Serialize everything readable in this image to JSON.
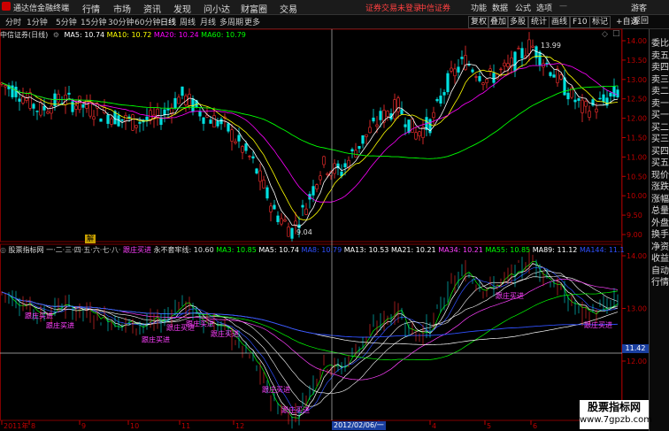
{
  "app": {
    "name": "通达信金融终端",
    "menus": [
      "行情",
      "市场",
      "资讯",
      "发现",
      "问小达",
      "财富圈",
      "交易"
    ],
    "notice": "证券交易未登录",
    "broker": "中信证券",
    "right_menus": [
      "功能",
      "数据",
      "公式",
      "选项"
    ],
    "guest": "游客"
  },
  "toolbar": {
    "periods": [
      "分时",
      "1分钟",
      "5分钟",
      "15分钟",
      "30分钟",
      "60分钟",
      "日线",
      "周线",
      "月线",
      "多周期",
      "更多"
    ],
    "active_period": "日线",
    "buttons": [
      "复权",
      "叠加",
      "多股",
      "统计",
      "画线",
      "F10",
      "标记"
    ],
    "self_select": "+自选",
    "back": "返回"
  },
  "main_chart": {
    "title": "中信证券(日线)",
    "ma": [
      {
        "label": "MA5: 10.74",
        "color": "#ffffff"
      },
      {
        "label": "MA10: 10.72",
        "color": "#ffff00"
      },
      {
        "label": "MA20: 10.24",
        "color": "#ff00ff"
      },
      {
        "label": "MA60: 10.79",
        "color": "#00ff00"
      }
    ],
    "price_ticks": [
      "14.00",
      "13.50",
      "13.00",
      "12.50",
      "12.00",
      "11.50",
      "11.00",
      "10.50",
      "10.00",
      "9.50",
      "9.00"
    ],
    "high_label": "13.99",
    "low_label": "9.04"
  },
  "sub_chart": {
    "title": "股票指标网",
    "numbers": [
      "一",
      "二",
      "三",
      "四",
      "五",
      "六",
      "七",
      "八"
    ],
    "follow_label": "跟庄买进",
    "never_label": "永不套牢线: 10.60",
    "ma": [
      {
        "label": "MA3: 10.85",
        "color": "#00ff00"
      },
      {
        "label": "MA5: 10.74",
        "color": "#ffffff"
      },
      {
        "label": "MA8: 10.79",
        "color": "#3050ff"
      },
      {
        "label": "MA13: 10.53",
        "color": "#ffffff"
      },
      {
        "label": "MA21: 10.21",
        "color": "#ffffff"
      },
      {
        "label": "MA34: 10.21",
        "color": "#ff40ff"
      },
      {
        "label": "MA55: 10.85",
        "color": "#00ff00"
      },
      {
        "label": "MA89: 11.12",
        "color": "#ffffff"
      },
      {
        "label": "MA144: 11.1",
        "color": "#3050ff"
      }
    ],
    "price_ticks": [
      "14.00",
      "13.00",
      "12.00"
    ],
    "current_badge": "11.42",
    "jie_label": "解",
    "buy_signals": [
      "跟庄买进",
      "跟庄买进",
      "跟庄买进",
      "跟庄买进",
      "跟庄买进",
      "跟庄买进",
      "跟庄买进",
      "跟庄买进",
      "跟庄买进",
      "跟庄买进"
    ]
  },
  "dates": [
    "2011年",
    "8",
    "9",
    "10",
    "11",
    "12",
    "2012/02/06/一",
    "3",
    "4",
    "5",
    "6",
    "7"
  ],
  "right_panel": [
    "委比",
    "卖五",
    "卖四",
    "卖三",
    "卖二",
    "卖一",
    "买一",
    "买二",
    "买三",
    "买四",
    "买五",
    "现价",
    "涨跌",
    "涨幅",
    "总量",
    "外盘",
    "换手",
    "净资",
    "收益",
    "自动",
    "行情"
  ],
  "watermark": {
    "line1": "股票指标网",
    "line2": "www.7gpzb.com"
  }
}
